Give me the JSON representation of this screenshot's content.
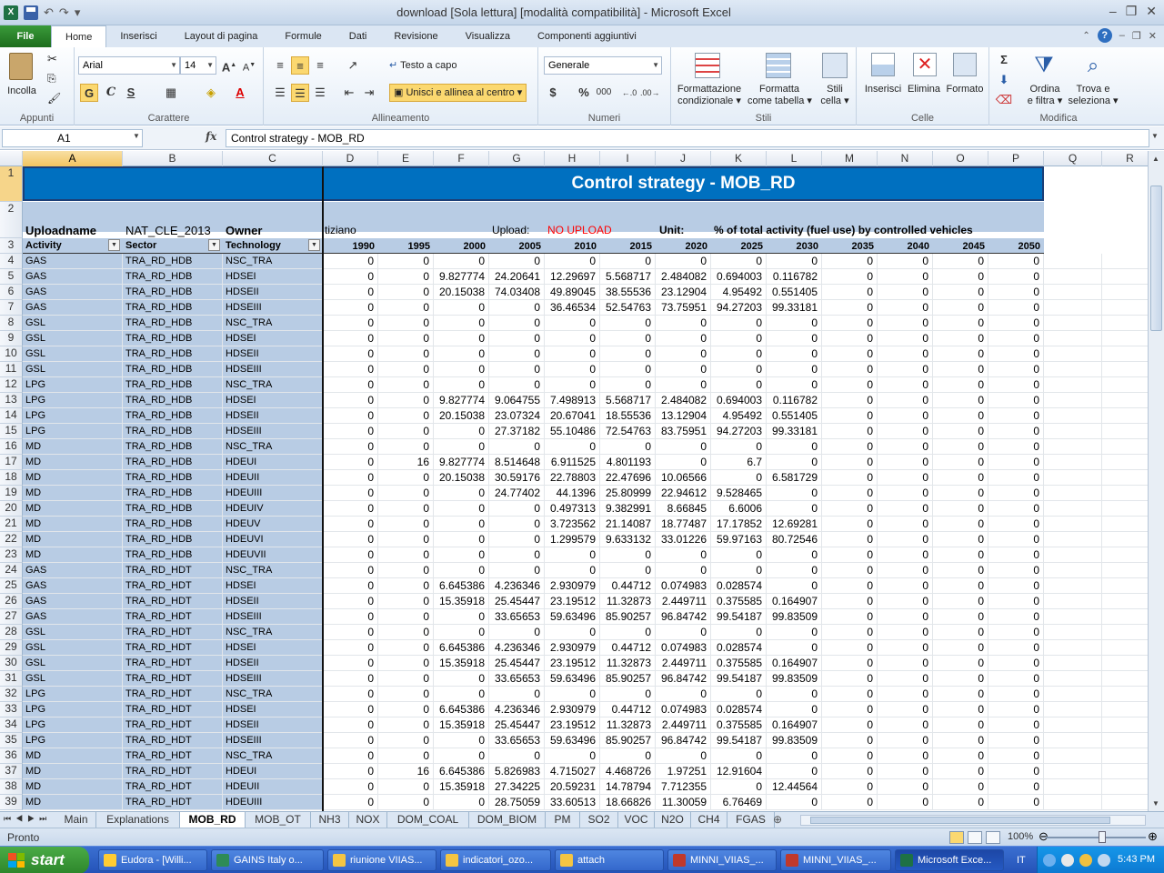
{
  "window": {
    "title": "download  [Sola lettura]  [modalità compatibilità]  -  Microsoft Excel"
  },
  "qat": {
    "app_icon": "X"
  },
  "ribbon_tabs": [
    "File",
    "Home",
    "Inserisci",
    "Layout di pagina",
    "Formule",
    "Dati",
    "Revisione",
    "Visualizza",
    "Componenti aggiuntivi"
  ],
  "ribbon": {
    "appunti": {
      "label": "Appunti",
      "paste": "Incolla"
    },
    "carattere": {
      "label": "Carattere",
      "font": "Arial",
      "size": "14",
      "bold": "G",
      "italic": "C",
      "underline": "S"
    },
    "allineamento": {
      "label": "Allineamento",
      "wrap": "Testo a capo",
      "merge": "Unisci e allinea al centro"
    },
    "numeri": {
      "label": "Numeri",
      "format": "Generale"
    },
    "stili": {
      "label": "Stili",
      "cond1": "Formattazione",
      "cond2": "condizionale",
      "table1": "Formatta",
      "table2": "come tabella",
      "cell1": "Stili",
      "cell2": "cella"
    },
    "celle": {
      "label": "Celle",
      "insert": "Inserisci",
      "delete": "Elimina",
      "format": "Formato"
    },
    "modifica": {
      "label": "Modifica",
      "sort1": "Ordina",
      "sort2": "e filtra",
      "find1": "Trova e",
      "find2": "seleziona"
    }
  },
  "formula_bar": {
    "name_box": "A1",
    "fx": "fx",
    "content": "Control strategy - MOB_RD"
  },
  "columns": [
    "A",
    "B",
    "C",
    "D",
    "E",
    "F",
    "G",
    "H",
    "I",
    "J",
    "K",
    "L",
    "M",
    "N",
    "O",
    "P",
    "Q",
    "R"
  ],
  "sheet": {
    "title": "Control strategy - MOB_RD",
    "row2": {
      "uploadname": "Uploadname",
      "scenario": "NAT_CLE_2013",
      "owner": "Owner",
      "user": "tiziano",
      "upload_label": "Upload:",
      "upload_value": "NO UPLOAD",
      "unit_label": "Unit:",
      "unit_value": "% of total activity (fuel use) by controlled vehicles"
    },
    "headers": {
      "activity": "Activity",
      "sector": "Sector",
      "technology": "Technology"
    },
    "years": [
      "1990",
      "1995",
      "2000",
      "2005",
      "2010",
      "2015",
      "2020",
      "2025",
      "2030",
      "2035",
      "2040",
      "2045",
      "2050"
    ],
    "rows": [
      {
        "n": "4",
        "a": "GAS",
        "s": "TRA_RD_HDB",
        "t": "NSC_TRA",
        "v": [
          "0",
          "0",
          "0",
          "0",
          "0",
          "0",
          "0",
          "0",
          "0",
          "0",
          "0",
          "0",
          "0"
        ]
      },
      {
        "n": "5",
        "a": "GAS",
        "s": "TRA_RD_HDB",
        "t": "HDSEI",
        "v": [
          "0",
          "0",
          "9.827774",
          "24.20641",
          "12.29697",
          "5.568717",
          "2.484082",
          "0.694003",
          "0.116782",
          "0",
          "0",
          "0",
          "0"
        ]
      },
      {
        "n": "6",
        "a": "GAS",
        "s": "TRA_RD_HDB",
        "t": "HDSEII",
        "v": [
          "0",
          "0",
          "20.15038",
          "74.03408",
          "49.89045",
          "38.55536",
          "23.12904",
          "4.95492",
          "0.551405",
          "0",
          "0",
          "0",
          "0"
        ]
      },
      {
        "n": "7",
        "a": "GAS",
        "s": "TRA_RD_HDB",
        "t": "HDSEIII",
        "v": [
          "0",
          "0",
          "0",
          "0",
          "36.46534",
          "52.54763",
          "73.75951",
          "94.27203",
          "99.33181",
          "0",
          "0",
          "0",
          "0"
        ]
      },
      {
        "n": "8",
        "a": "GSL",
        "s": "TRA_RD_HDB",
        "t": "NSC_TRA",
        "v": [
          "0",
          "0",
          "0",
          "0",
          "0",
          "0",
          "0",
          "0",
          "0",
          "0",
          "0",
          "0",
          "0"
        ]
      },
      {
        "n": "9",
        "a": "GSL",
        "s": "TRA_RD_HDB",
        "t": "HDSEI",
        "v": [
          "0",
          "0",
          "0",
          "0",
          "0",
          "0",
          "0",
          "0",
          "0",
          "0",
          "0",
          "0",
          "0"
        ]
      },
      {
        "n": "10",
        "a": "GSL",
        "s": "TRA_RD_HDB",
        "t": "HDSEII",
        "v": [
          "0",
          "0",
          "0",
          "0",
          "0",
          "0",
          "0",
          "0",
          "0",
          "0",
          "0",
          "0",
          "0"
        ]
      },
      {
        "n": "11",
        "a": "GSL",
        "s": "TRA_RD_HDB",
        "t": "HDSEIII",
        "v": [
          "0",
          "0",
          "0",
          "0",
          "0",
          "0",
          "0",
          "0",
          "0",
          "0",
          "0",
          "0",
          "0"
        ]
      },
      {
        "n": "12",
        "a": "LPG",
        "s": "TRA_RD_HDB",
        "t": "NSC_TRA",
        "v": [
          "0",
          "0",
          "0",
          "0",
          "0",
          "0",
          "0",
          "0",
          "0",
          "0",
          "0",
          "0",
          "0"
        ]
      },
      {
        "n": "13",
        "a": "LPG",
        "s": "TRA_RD_HDB",
        "t": "HDSEI",
        "v": [
          "0",
          "0",
          "9.827774",
          "9.064755",
          "7.498913",
          "5.568717",
          "2.484082",
          "0.694003",
          "0.116782",
          "0",
          "0",
          "0",
          "0"
        ]
      },
      {
        "n": "14",
        "a": "LPG",
        "s": "TRA_RD_HDB",
        "t": "HDSEII",
        "v": [
          "0",
          "0",
          "20.15038",
          "23.07324",
          "20.67041",
          "18.55536",
          "13.12904",
          "4.95492",
          "0.551405",
          "0",
          "0",
          "0",
          "0"
        ]
      },
      {
        "n": "15",
        "a": "LPG",
        "s": "TRA_RD_HDB",
        "t": "HDSEIII",
        "v": [
          "0",
          "0",
          "0",
          "27.37182",
          "55.10486",
          "72.54763",
          "83.75951",
          "94.27203",
          "99.33181",
          "0",
          "0",
          "0",
          "0"
        ]
      },
      {
        "n": "16",
        "a": "MD",
        "s": "TRA_RD_HDB",
        "t": "NSC_TRA",
        "v": [
          "0",
          "0",
          "0",
          "0",
          "0",
          "0",
          "0",
          "0",
          "0",
          "0",
          "0",
          "0",
          "0"
        ]
      },
      {
        "n": "17",
        "a": "MD",
        "s": "TRA_RD_HDB",
        "t": "HDEUI",
        "v": [
          "0",
          "16",
          "9.827774",
          "8.514648",
          "6.911525",
          "4.801193",
          "0",
          "6.7",
          "0",
          "0",
          "0",
          "0",
          "0"
        ]
      },
      {
        "n": "18",
        "a": "MD",
        "s": "TRA_RD_HDB",
        "t": "HDEUII",
        "v": [
          "0",
          "0",
          "20.15038",
          "30.59176",
          "22.78803",
          "22.47696",
          "10.06566",
          "0",
          "6.581729",
          "0",
          "0",
          "0",
          "0"
        ]
      },
      {
        "n": "19",
        "a": "MD",
        "s": "TRA_RD_HDB",
        "t": "HDEUIII",
        "v": [
          "0",
          "0",
          "0",
          "24.77402",
          "44.1396",
          "25.80999",
          "22.94612",
          "9.528465",
          "0",
          "0",
          "0",
          "0",
          "0"
        ]
      },
      {
        "n": "20",
        "a": "MD",
        "s": "TRA_RD_HDB",
        "t": "HDEUIV",
        "v": [
          "0",
          "0",
          "0",
          "0",
          "0.497313",
          "9.382991",
          "8.66845",
          "6.6006",
          "0",
          "0",
          "0",
          "0",
          "0"
        ]
      },
      {
        "n": "21",
        "a": "MD",
        "s": "TRA_RD_HDB",
        "t": "HDEUV",
        "v": [
          "0",
          "0",
          "0",
          "0",
          "3.723562",
          "21.14087",
          "18.77487",
          "17.17852",
          "12.69281",
          "0",
          "0",
          "0",
          "0"
        ]
      },
      {
        "n": "22",
        "a": "MD",
        "s": "TRA_RD_HDB",
        "t": "HDEUVI",
        "v": [
          "0",
          "0",
          "0",
          "0",
          "1.299579",
          "9.633132",
          "33.01226",
          "59.97163",
          "80.72546",
          "0",
          "0",
          "0",
          "0"
        ]
      },
      {
        "n": "23",
        "a": "MD",
        "s": "TRA_RD_HDB",
        "t": "HDEUVII",
        "v": [
          "0",
          "0",
          "0",
          "0",
          "0",
          "0",
          "0",
          "0",
          "0",
          "0",
          "0",
          "0",
          "0"
        ]
      },
      {
        "n": "24",
        "a": "GAS",
        "s": "TRA_RD_HDT",
        "t": "NSC_TRA",
        "v": [
          "0",
          "0",
          "0",
          "0",
          "0",
          "0",
          "0",
          "0",
          "0",
          "0",
          "0",
          "0",
          "0"
        ]
      },
      {
        "n": "25",
        "a": "GAS",
        "s": "TRA_RD_HDT",
        "t": "HDSEI",
        "v": [
          "0",
          "0",
          "6.645386",
          "4.236346",
          "2.930979",
          "0.44712",
          "0.074983",
          "0.028574",
          "0",
          "0",
          "0",
          "0",
          "0"
        ]
      },
      {
        "n": "26",
        "a": "GAS",
        "s": "TRA_RD_HDT",
        "t": "HDSEII",
        "v": [
          "0",
          "0",
          "15.35918",
          "25.45447",
          "23.19512",
          "11.32873",
          "2.449711",
          "0.375585",
          "0.164907",
          "0",
          "0",
          "0",
          "0"
        ]
      },
      {
        "n": "27",
        "a": "GAS",
        "s": "TRA_RD_HDT",
        "t": "HDSEIII",
        "v": [
          "0",
          "0",
          "0",
          "33.65653",
          "59.63496",
          "85.90257",
          "96.84742",
          "99.54187",
          "99.83509",
          "0",
          "0",
          "0",
          "0"
        ]
      },
      {
        "n": "28",
        "a": "GSL",
        "s": "TRA_RD_HDT",
        "t": "NSC_TRA",
        "v": [
          "0",
          "0",
          "0",
          "0",
          "0",
          "0",
          "0",
          "0",
          "0",
          "0",
          "0",
          "0",
          "0"
        ]
      },
      {
        "n": "29",
        "a": "GSL",
        "s": "TRA_RD_HDT",
        "t": "HDSEI",
        "v": [
          "0",
          "0",
          "6.645386",
          "4.236346",
          "2.930979",
          "0.44712",
          "0.074983",
          "0.028574",
          "0",
          "0",
          "0",
          "0",
          "0"
        ]
      },
      {
        "n": "30",
        "a": "GSL",
        "s": "TRA_RD_HDT",
        "t": "HDSEII",
        "v": [
          "0",
          "0",
          "15.35918",
          "25.45447",
          "23.19512",
          "11.32873",
          "2.449711",
          "0.375585",
          "0.164907",
          "0",
          "0",
          "0",
          "0"
        ]
      },
      {
        "n": "31",
        "a": "GSL",
        "s": "TRA_RD_HDT",
        "t": "HDSEIII",
        "v": [
          "0",
          "0",
          "0",
          "33.65653",
          "59.63496",
          "85.90257",
          "96.84742",
          "99.54187",
          "99.83509",
          "0",
          "0",
          "0",
          "0"
        ]
      },
      {
        "n": "32",
        "a": "LPG",
        "s": "TRA_RD_HDT",
        "t": "NSC_TRA",
        "v": [
          "0",
          "0",
          "0",
          "0",
          "0",
          "0",
          "0",
          "0",
          "0",
          "0",
          "0",
          "0",
          "0"
        ]
      },
      {
        "n": "33",
        "a": "LPG",
        "s": "TRA_RD_HDT",
        "t": "HDSEI",
        "v": [
          "0",
          "0",
          "6.645386",
          "4.236346",
          "2.930979",
          "0.44712",
          "0.074983",
          "0.028574",
          "0",
          "0",
          "0",
          "0",
          "0"
        ]
      },
      {
        "n": "34",
        "a": "LPG",
        "s": "TRA_RD_HDT",
        "t": "HDSEII",
        "v": [
          "0",
          "0",
          "15.35918",
          "25.45447",
          "23.19512",
          "11.32873",
          "2.449711",
          "0.375585",
          "0.164907",
          "0",
          "0",
          "0",
          "0"
        ]
      },
      {
        "n": "35",
        "a": "LPG",
        "s": "TRA_RD_HDT",
        "t": "HDSEIII",
        "v": [
          "0",
          "0",
          "0",
          "33.65653",
          "59.63496",
          "85.90257",
          "96.84742",
          "99.54187",
          "99.83509",
          "0",
          "0",
          "0",
          "0"
        ]
      },
      {
        "n": "36",
        "a": "MD",
        "s": "TRA_RD_HDT",
        "t": "NSC_TRA",
        "v": [
          "0",
          "0",
          "0",
          "0",
          "0",
          "0",
          "0",
          "0",
          "0",
          "0",
          "0",
          "0",
          "0"
        ]
      },
      {
        "n": "37",
        "a": "MD",
        "s": "TRA_RD_HDT",
        "t": "HDEUI",
        "v": [
          "0",
          "16",
          "6.645386",
          "5.826983",
          "4.715027",
          "4.468726",
          "1.97251",
          "12.91604",
          "0",
          "0",
          "0",
          "0",
          "0"
        ]
      },
      {
        "n": "38",
        "a": "MD",
        "s": "TRA_RD_HDT",
        "t": "HDEUII",
        "v": [
          "0",
          "0",
          "15.35918",
          "27.34225",
          "20.59231",
          "14.78794",
          "7.712355",
          "0",
          "12.44564",
          "0",
          "0",
          "0",
          "0"
        ]
      },
      {
        "n": "39",
        "a": "MD",
        "s": "TRA_RD_HDT",
        "t": "HDEUIII",
        "v": [
          "0",
          "0",
          "0",
          "28.75059",
          "33.60513",
          "18.66826",
          "11.30059",
          "6.76469",
          "0",
          "0",
          "0",
          "0",
          "0"
        ]
      }
    ]
  },
  "sheet_tabs": [
    "Main",
    "Explanations",
    "MOB_RD",
    "MOB_OT",
    "NH3",
    "NOX",
    "DOM_COAL",
    "DOM_BIOM",
    "PM",
    "SO2",
    "VOC",
    "N2O",
    "CH4",
    "FGAS"
  ],
  "status": {
    "ready": "Pronto",
    "zoom": "100%"
  },
  "taskbar": {
    "start": "start",
    "items": [
      "Eudora - [Willi...",
      "GAINS Italy o...",
      "riunione VIIAS...",
      "indicatori_ozo...",
      "attach",
      "MINNI_VIIAS_...",
      "MINNI_VIIAS_...",
      "Microsoft Exce..."
    ],
    "lang": "IT",
    "clock": "5:43 PM"
  },
  "colors": {
    "title_band": "#0070c0",
    "header_band": "#b8cce4",
    "upload_red": "#ff0000",
    "file_tab": "#2e8b2e"
  }
}
